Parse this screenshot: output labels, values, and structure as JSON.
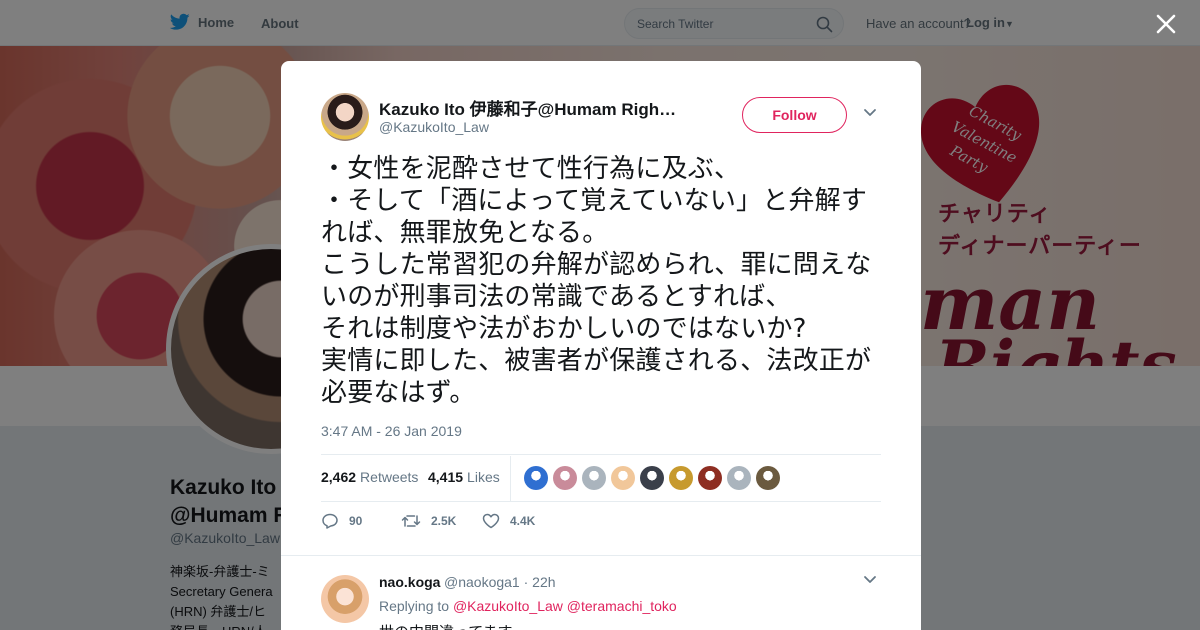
{
  "topnav": {
    "home_label": "Home",
    "about_label": "About",
    "search_placeholder": "Search Twitter",
    "have_account": "Have an account?",
    "login_label": "Log in"
  },
  "banner": {
    "heart_text": [
      "Charity",
      "Valentine",
      "Party"
    ],
    "jp_line1": "チャリティ",
    "jp_line2": "ディナーパーティー",
    "script1": "man",
    "script2": "Rights"
  },
  "profile": {
    "name_line1": "Kazuko Ito",
    "name_line2": "@Humam R",
    "handle": "@KazukoIto_Law",
    "bio_lines": [
      "神楽坂-弁護士-ミ",
      "Secretary Genera",
      "(HRN) 弁護士/ヒ",
      "務局長、HRN/人"
    ]
  },
  "tweet": {
    "author_name": "Kazuko Ito 伊藤和子@Humam Righ…",
    "author_handle": "@KazukoIto_Law",
    "follow_label": "Follow",
    "text": "・女性を泥酔させて性行為に及ぶ、\n・そして「酒によって覚えていない」と弁解すれば、無罪放免となる。\nこうした常習犯の弁解が認められ、罪に問えないのが刑事司法の常識であるとすれば、\nそれは制度や法がおかしいのではないか?\n実情に即した、被害者が保護される、法改正が必要なはず。",
    "timestamp": "3:47 AM - 26 Jan 2019",
    "retweets_count": "2,462",
    "retweets_label": "Retweets",
    "likes_count": "4,415",
    "likes_label": "Likes",
    "likers": [
      "#2f6fd1",
      "#c98b9a",
      "#aab4bd",
      "#f1c79a",
      "#3a3f4a",
      "#c79a2e",
      "#8e2e22",
      "#aab4bd",
      "#6b5a3f"
    ],
    "reply_count": "90",
    "retweet_short": "2.5K",
    "like_short": "4.4K"
  },
  "reply": {
    "name": "nao.koga",
    "handle": "@naokoga1",
    "time": "· 22h",
    "replying_label": "Replying to",
    "mention1": "@KazukoIto_Law",
    "mention2": "@teramachi_toko",
    "text": "世の中間違ってます"
  },
  "colors": {
    "accent": "#e0245e",
    "twitter_blue": "#1da1f2",
    "muted": "#657786"
  }
}
